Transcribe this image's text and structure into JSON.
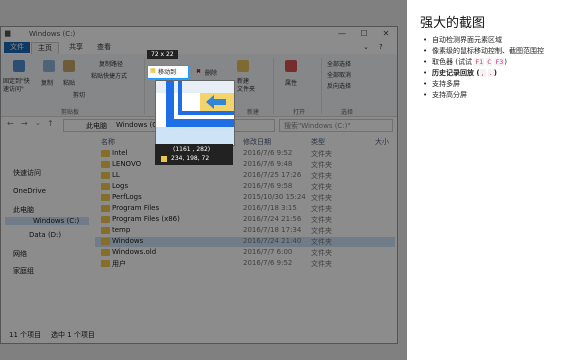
{
  "explorer": {
    "window_title": "Windows (C:)",
    "controls": {
      "minimize": "—",
      "maximize": "☐",
      "close": "✕",
      "help": "?",
      "expand": "⌄"
    },
    "menu_tabs": [
      "文件",
      "主页",
      "共享",
      "查看"
    ],
    "ribbon": {
      "pin_label": "固定到\"快\n速访问\"",
      "copy": "复制",
      "paste": "粘贴",
      "cut": "剪切",
      "copy_path": "复制路径",
      "paste_shortcut": "粘贴快捷方式",
      "move_to": "移动到",
      "delete": "删除",
      "new": "新建",
      "new_folder": "新建\n文件夹",
      "properties": "属性",
      "select_all": "全部选择",
      "select_none": "全部取消",
      "invert_selection": "反向选择",
      "groups": {
        "clipboard": "剪贴板",
        "new": "新建",
        "open": "打开",
        "select": "选择"
      }
    },
    "address": {
      "path": [
        "此电脑",
        "Windows (C:)"
      ],
      "search_placeholder": "搜索\"Windows (C:)\""
    },
    "nav": {
      "quick_access": "快速访问",
      "onedrive": "OneDrive",
      "this_pc": "此电脑",
      "windows_c": "Windows (C:)",
      "data_d": "Data (D:)",
      "network": "网络",
      "homegroup": "家庭组"
    },
    "columns": {
      "name": "名称",
      "date": "修改日期",
      "type": "类型",
      "size": "大小"
    },
    "files": [
      {
        "name": "Intel",
        "date": "2016/7/6 9:52",
        "type": "文件夹"
      },
      {
        "name": "LENOVO",
        "date": "2016/7/6 9:48",
        "type": "文件夹"
      },
      {
        "name": "LL",
        "date": "2016/7/25 17:26",
        "type": "文件夹"
      },
      {
        "name": "Logs",
        "date": "2016/7/6 9:58",
        "type": "文件夹"
      },
      {
        "name": "PerfLogs",
        "date": "2015/10/30 15:24",
        "type": "文件夹"
      },
      {
        "name": "Program Files",
        "date": "2016/7/18 3:15",
        "type": "文件夹"
      },
      {
        "name": "Program Files (x86)",
        "date": "2016/7/24 21:56",
        "type": "文件夹"
      },
      {
        "name": "temp",
        "date": "2016/7/18 17:34",
        "type": "文件夹"
      },
      {
        "name": "Windows",
        "date": "2016/7/24 21:40",
        "type": "文件夹"
      },
      {
        "name": "Windows.old",
        "date": "2016/7/7 6:00",
        "type": "文件夹"
      },
      {
        "name": "用户",
        "date": "2016/7/6 9:52",
        "type": "文件夹"
      }
    ],
    "status": {
      "count": "11 个项目",
      "selected": "选中 1 个项目"
    }
  },
  "capture": {
    "size_label": "72 x 22",
    "coords": "(1161 , 282)",
    "rgb": "234, 198,  72",
    "swatch_color": "#eac648"
  },
  "panel": {
    "title": "强大的截图",
    "features": [
      {
        "text": "自动检测界面元素区域",
        "bold": false
      },
      {
        "text": "像素级的鼠标移动控制、截图范围控",
        "bold": false
      },
      {
        "text": "取色器 (试试 ",
        "bold": false,
        "codes": [
          "F1",
          "C",
          "F3"
        ],
        "suffix": ")"
      },
      {
        "text": "历史记录回放 (",
        "bold": true,
        "codes": [
          ",",
          "."
        ],
        "suffix": ")"
      },
      {
        "text": "支持多屏",
        "bold": false
      },
      {
        "text": "支持高分屏",
        "bold": false
      }
    ]
  }
}
